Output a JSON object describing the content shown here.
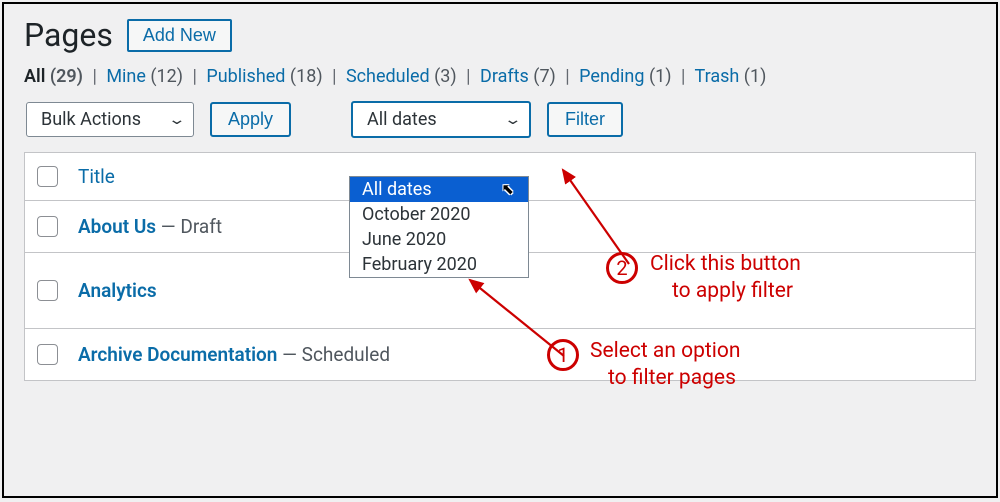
{
  "header": {
    "title": "Pages",
    "add_new": "Add New"
  },
  "views": {
    "all_label": "All",
    "all_count": "(29)",
    "mine_label": "Mine",
    "mine_count": "(12)",
    "pub_label": "Published",
    "pub_count": "(18)",
    "sched_label": "Scheduled",
    "sched_count": "(3)",
    "drafts_label": "Drafts",
    "drafts_count": "(7)",
    "pending_label": "Pending",
    "pending_count": "(1)",
    "trash_label": "Trash",
    "trash_count": "(1)"
  },
  "filters": {
    "bulk_label": "Bulk Actions",
    "apply_label": "Apply",
    "dates_label": "All dates",
    "filter_label": "Filter"
  },
  "dropdown": {
    "opt0": "All dates",
    "opt1": "October 2020",
    "opt2": "June 2020",
    "opt3": "February 2020"
  },
  "table": {
    "title_header": "Title",
    "r1_title": "About Us",
    "r1_status": "Draft",
    "r2_title": "Analytics",
    "r3_title": "Archive Documentation",
    "r3_status": "Scheduled"
  },
  "anno": {
    "c1": "1",
    "c2": "2",
    "t1a": "Select an option",
    "t1b": "to filter pages",
    "t2a": "Click this button",
    "t2b": "to apply filter"
  }
}
